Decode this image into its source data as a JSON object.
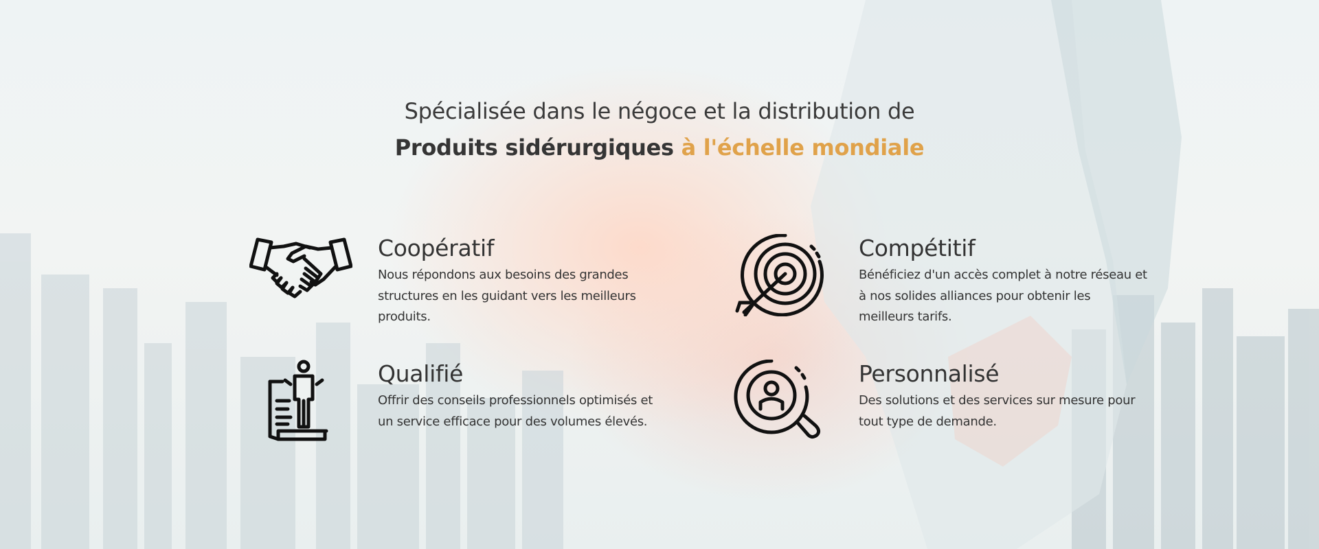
{
  "heading": {
    "line1": "Spécialisée dans le négoce et la distribution de",
    "line2_bold": "Produits sidérurgiques",
    "line2_accent": "à l'échelle mondiale"
  },
  "features": [
    {
      "title": "Coopératif",
      "description": "Nous répondons aux besoins des grandes structures en les guidant vers les meilleurs produits.",
      "icon": "handshake-icon"
    },
    {
      "title": "Compétitif",
      "description": "Bénéficiez d'un accès complet à notre réseau et à nos solides alliances pour obtenir les meilleurs tarifs.",
      "icon": "target-arrow-icon"
    },
    {
      "title": "Qualifié",
      "description": "Offrir des conseils professionnels optimisés et un service efficace pour des volumes élevés.",
      "icon": "person-on-document-icon"
    },
    {
      "title": "Personnalisé",
      "description": "Des solutions et des services sur mesure pour tout type de demande.",
      "icon": "magnifier-person-icon"
    }
  ],
  "colors": {
    "accent": "#e0a24a",
    "text": "#333333"
  }
}
